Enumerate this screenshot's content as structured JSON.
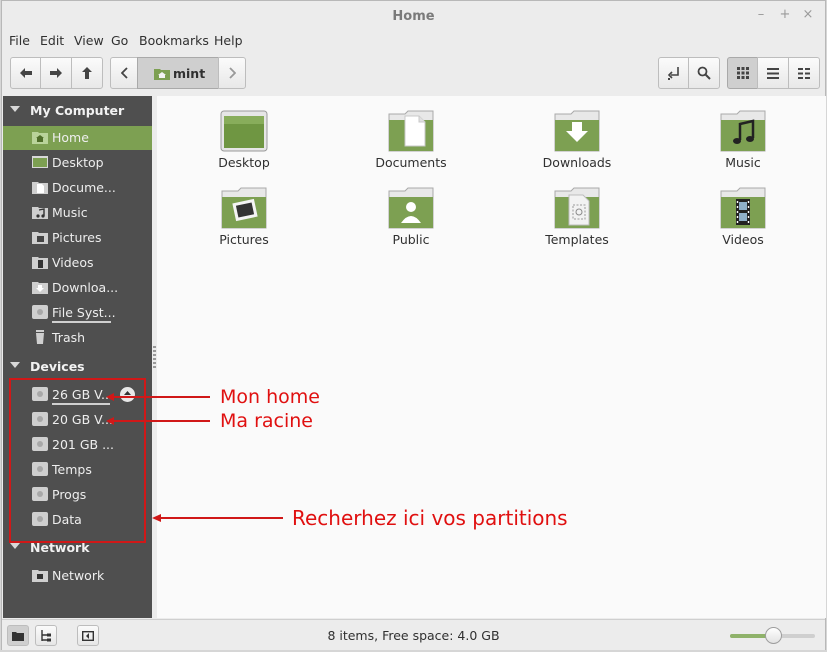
{
  "window": {
    "title": "Home",
    "controls": {
      "minimize": "–",
      "maximize": "+",
      "close": "×"
    }
  },
  "menu": [
    "File",
    "Edit",
    "View",
    "Go",
    "Bookmarks",
    "Help"
  ],
  "toolbar": {
    "path_button": "mint"
  },
  "sidebar": {
    "sections": [
      {
        "title": "My Computer",
        "items": [
          {
            "label": "Home",
            "icon": "home-folder-icon",
            "selected": true
          },
          {
            "label": "Desktop",
            "icon": "desktop-icon"
          },
          {
            "label": "Docume...",
            "icon": "documents-folder-icon"
          },
          {
            "label": "Music",
            "icon": "music-folder-icon"
          },
          {
            "label": "Pictures",
            "icon": "pictures-folder-icon"
          },
          {
            "label": "Videos",
            "icon": "videos-folder-icon"
          },
          {
            "label": "Downloa...",
            "icon": "downloads-folder-icon"
          },
          {
            "label": "File Syst...",
            "icon": "drive-icon"
          },
          {
            "label": "Trash",
            "icon": "trash-icon"
          }
        ]
      },
      {
        "title": "Devices",
        "items": [
          {
            "label": "26 GB V...",
            "icon": "drive-icon",
            "eject": true
          },
          {
            "label": "20 GB V...",
            "icon": "drive-icon"
          },
          {
            "label": "201 GB ...",
            "icon": "drive-icon"
          },
          {
            "label": "Temps",
            "icon": "drive-icon"
          },
          {
            "label": "Progs",
            "icon": "drive-icon"
          },
          {
            "label": "Data",
            "icon": "drive-icon"
          }
        ]
      },
      {
        "title": "Network",
        "items": [
          {
            "label": "Network",
            "icon": "network-icon"
          }
        ]
      }
    ]
  },
  "files": [
    {
      "label": "Desktop",
      "icon": "desktop-folder-icon"
    },
    {
      "label": "Documents",
      "icon": "documents-folder-icon"
    },
    {
      "label": "Downloads",
      "icon": "downloads-folder-icon"
    },
    {
      "label": "Music",
      "icon": "music-folder-icon"
    },
    {
      "label": "Pictures",
      "icon": "pictures-folder-icon"
    },
    {
      "label": "Public",
      "icon": "public-folder-icon"
    },
    {
      "label": "Templates",
      "icon": "templates-folder-icon"
    },
    {
      "label": "Videos",
      "icon": "videos-folder-icon"
    }
  ],
  "status": {
    "text": "8 items, Free space: 4.0 GB",
    "zoom_level": 0.5
  },
  "annotations": {
    "home": "Mon home",
    "root": "Ma racine",
    "partitions": "Recherhez ici vos partitions"
  },
  "colors": {
    "accent": "#7da052",
    "annotation": "#e01010",
    "sidebar_bg": "#4f4f4f"
  }
}
